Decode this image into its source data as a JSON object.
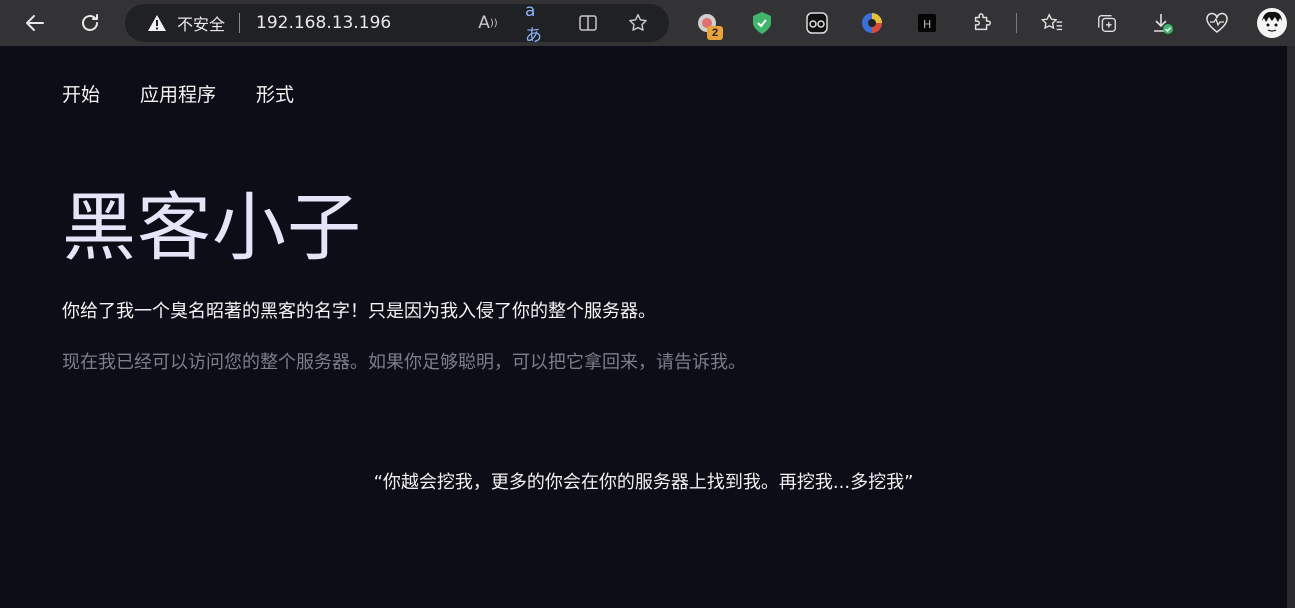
{
  "browser": {
    "security_label": "不安全",
    "url": "192.168.13.196",
    "extension_badge": "2",
    "icons": [
      "back-icon",
      "reload-icon",
      "warning-icon",
      "read-aloud-icon",
      "translate-icon",
      "split-screen-icon",
      "favorite-star-icon",
      "extension-icon",
      "shield-extension-icon",
      "mask-extension-icon",
      "color-wheel-extension-icon",
      "h-extension-icon",
      "extensions-puzzle-icon",
      "favorites-icon",
      "collections-icon",
      "downloads-icon",
      "health-icon",
      "profile-avatar"
    ]
  },
  "nav": {
    "items": [
      "开始",
      "应用程序",
      "形式"
    ]
  },
  "hero": {
    "title": "黑客小子",
    "lead": "你给了我一个臭名昭著的黑客的名字！只是因为我入侵了你的整个服务器。",
    "sub": "现在我已经可以访问您的整个服务器。如果你足够聪明，可以把它拿回来，请告诉我。"
  },
  "quote": "“你越会挖我，更多的你会在你的服务器上找到我。再挖我...多挖我”"
}
